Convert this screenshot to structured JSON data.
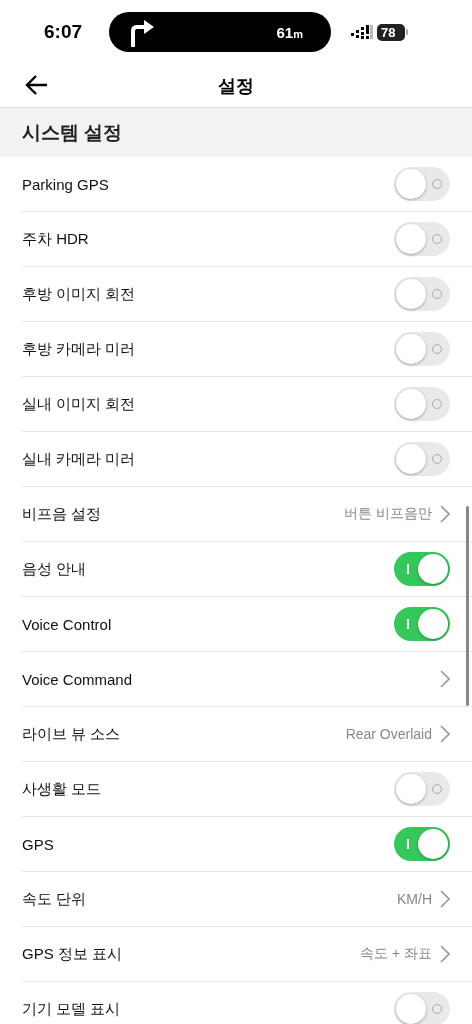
{
  "status_bar": {
    "time": "6:07",
    "navigation": {
      "distance": "61",
      "unit": "m"
    },
    "battery": "78"
  },
  "header": {
    "title": "설정"
  },
  "section": {
    "title": "시스템 설정"
  },
  "rows": [
    {
      "kind": "toggle",
      "label": "Parking GPS",
      "on": false
    },
    {
      "kind": "toggle",
      "label": "주차 HDR",
      "on": false
    },
    {
      "kind": "toggle",
      "label": "후방 이미지 회전",
      "on": false
    },
    {
      "kind": "toggle",
      "label": "후방 카메라 미러",
      "on": false
    },
    {
      "kind": "toggle",
      "label": "실내 이미지 회전",
      "on": false
    },
    {
      "kind": "toggle",
      "label": "실내 카메라 미러",
      "on": false
    },
    {
      "kind": "link",
      "label": "비프음 설정",
      "value": "버튼 비프음만"
    },
    {
      "kind": "toggle",
      "label": "음성 안내",
      "on": true
    },
    {
      "kind": "toggle",
      "label": "Voice Control",
      "on": true
    },
    {
      "kind": "link",
      "label": "Voice Command"
    },
    {
      "kind": "link",
      "label": "라이브 뷰 소스",
      "value": "Rear Overlaid"
    },
    {
      "kind": "toggle",
      "label": "사생활 모드",
      "on": false
    },
    {
      "kind": "toggle",
      "label": "GPS",
      "on": true
    },
    {
      "kind": "link",
      "label": "속도 단위",
      "value": "KM/H"
    },
    {
      "kind": "link",
      "label": "GPS 정보 표시",
      "value": "속도 + 좌표"
    },
    {
      "kind": "toggle",
      "label": "기기 모델 표시",
      "on": false
    }
  ]
}
